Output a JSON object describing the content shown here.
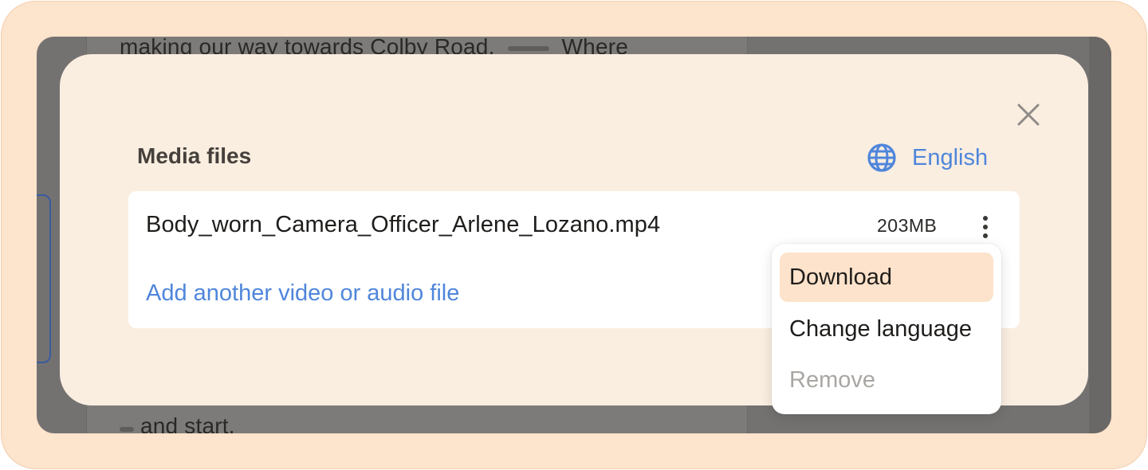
{
  "background": {
    "top_text": "making our way towards Colby Road.",
    "top_text_2": "Where",
    "bottom_text": "and start."
  },
  "modal": {
    "title": "Media files",
    "close_icon": "close-icon",
    "language": {
      "icon": "globe-icon",
      "label": "English"
    },
    "files": [
      {
        "name": "Body_worn_Camera_Officer_Arlene_Lozano.mp4",
        "size": "203MB",
        "menu_icon": "more-vertical-icon"
      }
    ],
    "add_file_label": "Add another video or audio file"
  },
  "context_menu": {
    "items": [
      {
        "label": "Download",
        "state": "highlighted"
      },
      {
        "label": "Change language",
        "state": "enabled"
      },
      {
        "label": "Remove",
        "state": "disabled"
      }
    ]
  },
  "colors": {
    "accent": "#4f86db",
    "frame": "#fde4cc",
    "modal_bg": "#faeee1",
    "menu_highlight": "#fde3cb"
  }
}
